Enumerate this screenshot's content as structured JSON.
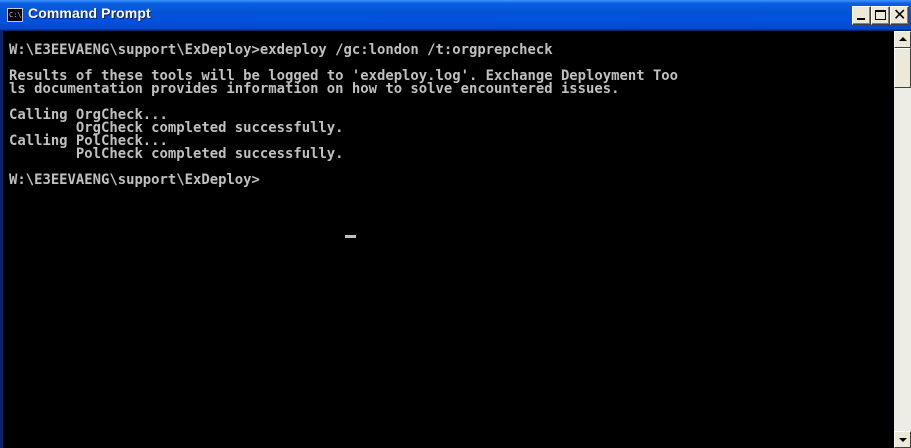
{
  "window": {
    "title": "Command Prompt",
    "icon_label": "C:\\"
  },
  "console": {
    "lines": [
      "W:\\E3EEVAENG\\support\\ExDeploy>exdeploy /gc:london /t:orgprepcheck",
      "",
      "Results of these tools will be logged to 'exdeploy.log'. Exchange Deployment Too",
      "ls documentation provides information on how to solve encountered issues.",
      "",
      "Calling OrgCheck...",
      "        OrgCheck completed successfully.",
      "Calling PolCheck...",
      "        PolCheck completed successfully.",
      "",
      "W:\\E3EEVAENG\\support\\ExDeploy>"
    ]
  },
  "colors": {
    "console_background": "#000000",
    "console_text": "#c0c0c0",
    "titlebar": "#0454d6"
  },
  "icons": {
    "app": "command-prompt-icon",
    "minimize": "minimize-icon",
    "maximize": "maximize-icon",
    "close": "close-icon",
    "scroll_up": "arrow-up-icon",
    "scroll_down": "arrow-down-icon"
  }
}
